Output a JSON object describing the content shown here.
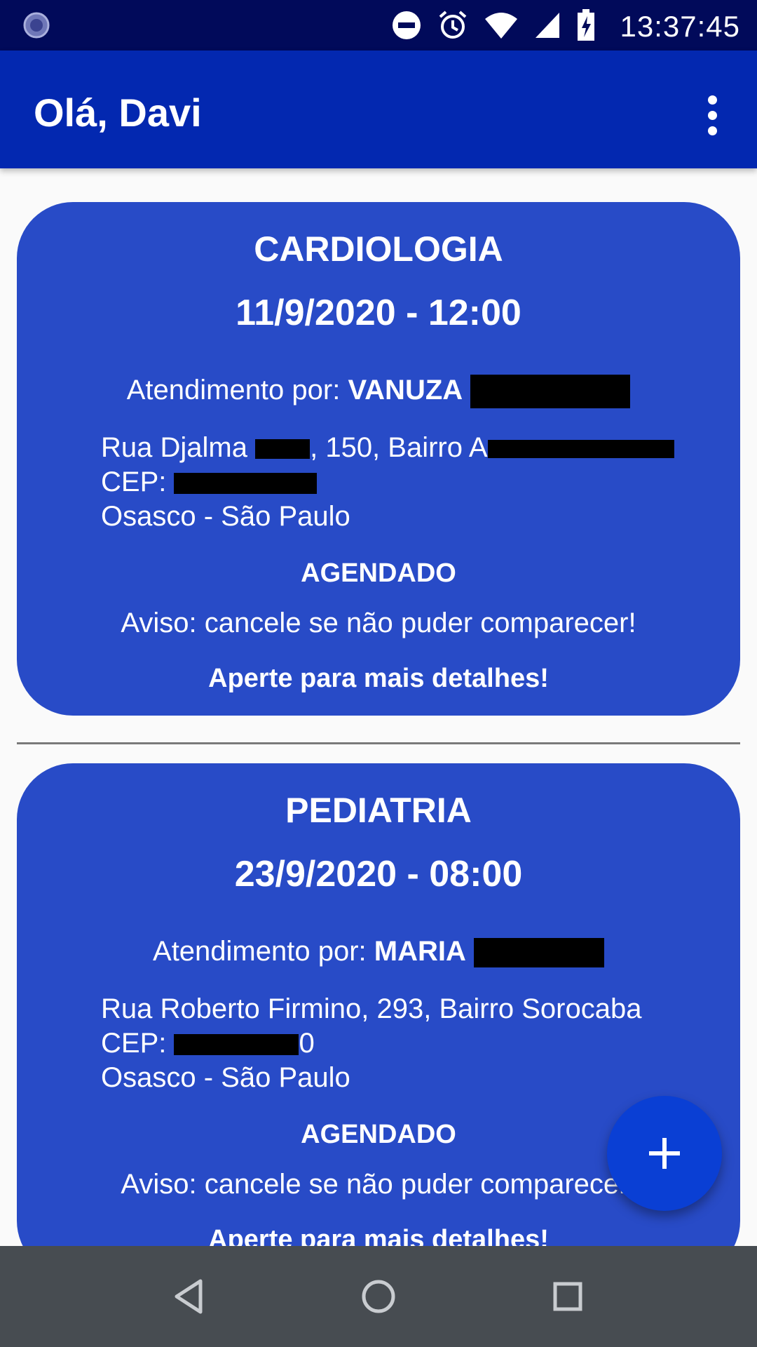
{
  "status_bar": {
    "time": "13:37:45",
    "icons": [
      "notification-icon",
      "do-not-disturb-icon",
      "alarm-icon",
      "wifi-icon",
      "signal-icon",
      "battery-charging-icon"
    ]
  },
  "app_bar": {
    "title": "Olá, Davi",
    "menu_icon": "more-vert-icon"
  },
  "appointments": [
    {
      "specialty": "CARDIOLOGIA",
      "datetime": "11/9/2020 - 12:00",
      "doctor_prefix": "Atendimento por: ",
      "doctor_name": "VANUZA",
      "address_street_a": "Rua Djalma",
      "address_street_b": ", 150, Bairro A",
      "cep_label": "CEP: ",
      "city": "Osasco - São Paulo",
      "status": "AGENDADO",
      "warning": "Aviso: cancele se não puder comparecer!",
      "details": "Aperte para mais detalhes!"
    },
    {
      "specialty": "PEDIATRIA",
      "datetime": "23/9/2020 - 08:00",
      "doctor_prefix": "Atendimento por: ",
      "doctor_name": "MARIA",
      "address_street": "Rua Roberto Firmino, 293, Bairro Sorocaba",
      "cep_label": "CEP: ",
      "cep_tail": "0",
      "city": "Osasco - São Paulo",
      "status": "AGENDADO",
      "warning": "Aviso: cancele se não puder comparecer!",
      "details": "Aperte para mais detalhes!"
    }
  ],
  "fab": {
    "icon": "plus-icon"
  },
  "nav_bar": {
    "icons": [
      "back-icon",
      "home-icon",
      "recents-icon"
    ]
  },
  "colors": {
    "status_bar": "#010a5a",
    "app_bar": "#0328b0",
    "card": "#284bc7",
    "fab": "#0a3fd4",
    "nav_bar": "#474c51"
  }
}
